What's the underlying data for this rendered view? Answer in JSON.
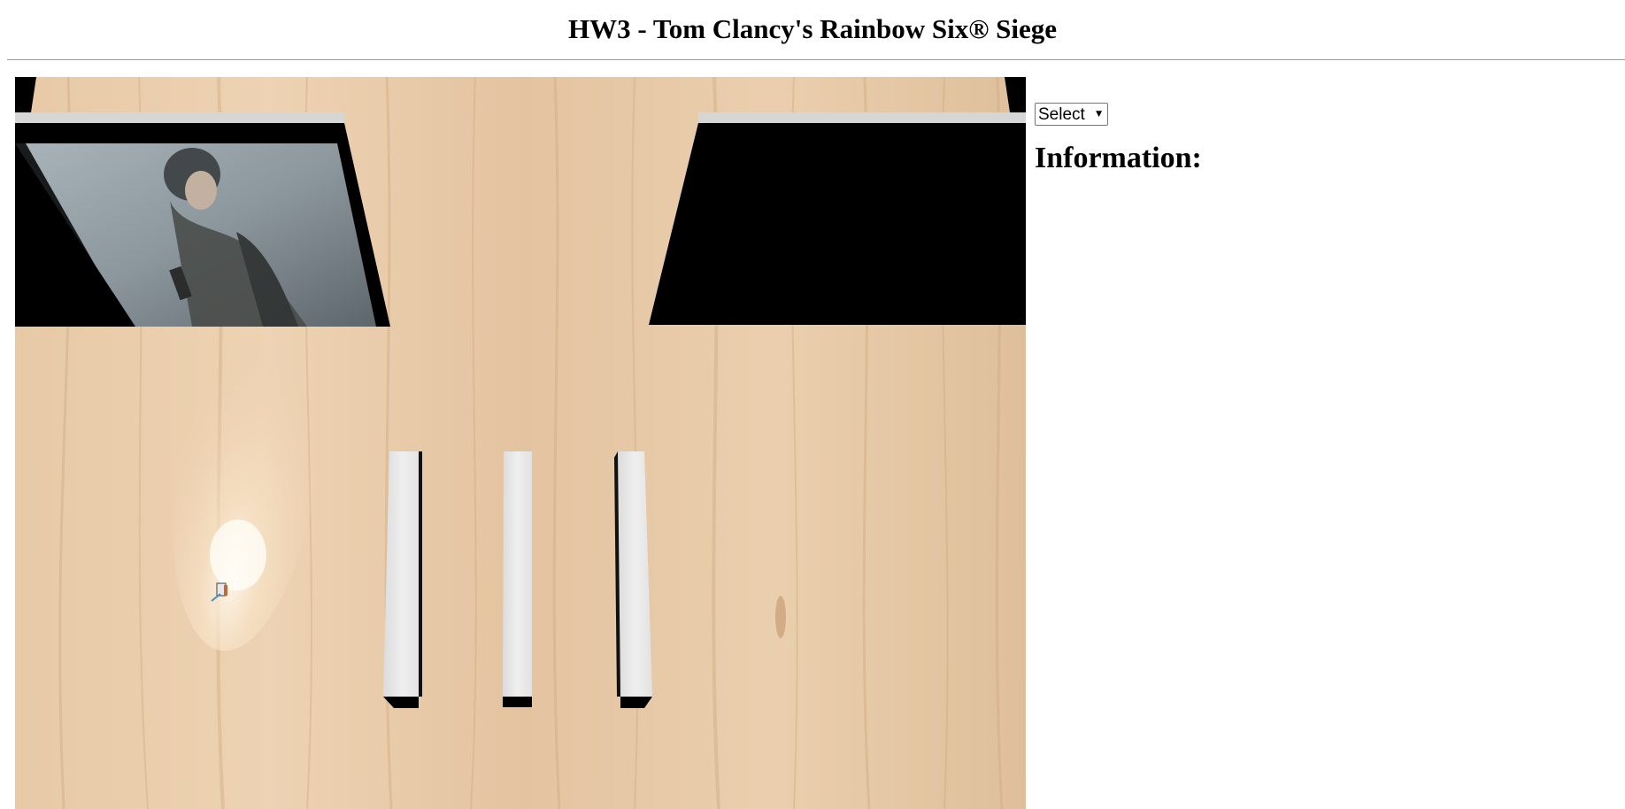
{
  "page": {
    "title": "HW3 - Tom Clancy's Rainbow Six® Siege"
  },
  "controls": {
    "select": {
      "selected": "Select",
      "options": [
        "Select"
      ]
    }
  },
  "info": {
    "heading": "Information:"
  },
  "scene": {
    "floor_color": "#e3c7a6",
    "wall_color": "#000000",
    "wall_top_color": "#d9d9d9",
    "pillar_color": "#e6e6e6",
    "icons": [
      "poster-image",
      "flashlight-beam",
      "operator-figure"
    ]
  }
}
